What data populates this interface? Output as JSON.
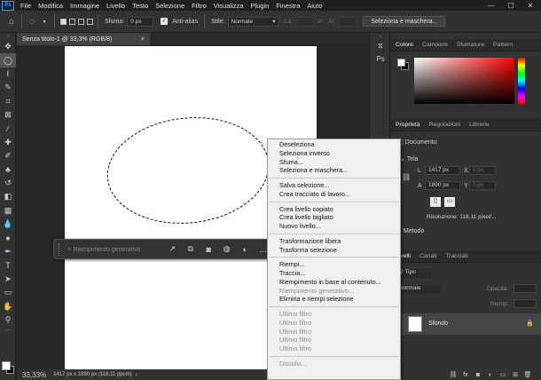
{
  "menubar": {
    "logo": "Ps",
    "items": [
      "File",
      "Modifica",
      "Immagine",
      "Livello",
      "Testo",
      "Selezione",
      "Filtro",
      "Visualizza",
      "Plugin",
      "Finestra",
      "Aiuto"
    ],
    "window_controls": [
      "—",
      "☐",
      "✕"
    ]
  },
  "options": {
    "home_icon": "home-icon",
    "marquee_icon": "ellipse-marquee-icon",
    "feather_label": "Sfuma:",
    "feather_value": "0 px",
    "antialias_label": "Anti-alias",
    "antialias_checked": true,
    "style_label": "Stile:",
    "style_value": "Normale",
    "width_label": "La:",
    "height_label": "Al:",
    "select_mask_button": "Seleziona e maschera..."
  },
  "document": {
    "tab_title": "Senza titolo-1 @ 33,3% (RGB/8)",
    "tab_close": "×",
    "canvas_color": "#ffffff"
  },
  "status": {
    "zoom": "33,33%",
    "dimensions": "1417 px x 1890 px (118,11 ppcm)"
  },
  "taskbar": {
    "generative_fill": "Riempimento generativo",
    "more_icon": "..."
  },
  "context_menu": {
    "groups": [
      [
        {
          "label": "Deseleziona",
          "enabled": true
        },
        {
          "label": "Seleziona inverso",
          "enabled": true
        },
        {
          "label": "Sfuma...",
          "enabled": true
        },
        {
          "label": "Seleziona e maschera...",
          "enabled": true
        }
      ],
      [
        {
          "label": "Salva selezione...",
          "enabled": true
        },
        {
          "label": "Crea tracciato di lavoro...",
          "enabled": true
        }
      ],
      [
        {
          "label": "Crea livello copiato",
          "enabled": true
        },
        {
          "label": "Crea livello tagliato",
          "enabled": true
        },
        {
          "label": "Nuovo livello...",
          "enabled": true
        }
      ],
      [
        {
          "label": "Trasformazione libera",
          "enabled": true
        },
        {
          "label": "Trasforma selezione",
          "enabled": true
        }
      ],
      [
        {
          "label": "Riempi...",
          "enabled": true
        },
        {
          "label": "Traccia...",
          "enabled": true
        },
        {
          "label": "Riempimento in base al contenuto...",
          "enabled": true
        },
        {
          "label": "Riempimento generativo...",
          "enabled": false
        },
        {
          "label": "Elimina e riempi selezione",
          "enabled": true
        }
      ],
      [
        {
          "label": "Ultimo filtro",
          "enabled": false
        },
        {
          "label": "Ultimo filtro",
          "enabled": false
        },
        {
          "label": "Ultimo filtro",
          "enabled": false
        },
        {
          "label": "Ultimo filtro",
          "enabled": false
        },
        {
          "label": "Ultimo filtro",
          "enabled": false
        }
      ],
      [
        {
          "label": "Dissolvi...",
          "enabled": false
        }
      ]
    ]
  },
  "color_panel": {
    "tabs": [
      "Colore",
      "Campioni",
      "Sfumature",
      "Pattern"
    ],
    "active_tab": "Colore",
    "foreground": "#ffffff",
    "background": "#000000"
  },
  "properties_panel": {
    "tabs": [
      "Proprietà",
      "Regolazioni",
      "Librerie"
    ],
    "active_tab": "Proprietà",
    "section": "Documento",
    "canvas_label": "Tela",
    "width_value": "1417 px",
    "height_value": "1890 px",
    "x_label": "X",
    "y_label": "Y",
    "x_placeholder": "0 px",
    "y_placeholder": "0 px",
    "w_label": "L",
    "h_label": "A",
    "resolution": "Risoluzione: 118,11 pixel/...",
    "mode_label": "Metodo"
  },
  "layers_panel": {
    "tabs": [
      "Livelli",
      "Canali",
      "Tracciati"
    ],
    "active_tab": "Livelli",
    "kind_label": "Tipo",
    "blend_mode": "Normale",
    "opacity_label": "Opacità:",
    "fill_label": "Riemp.:",
    "layer_name": "Sfondo"
  },
  "bottom_icons": [
    "link-icon",
    "fx-icon",
    "mask-icon",
    "adjustment-icon",
    "group-icon",
    "new-layer-icon",
    "trash-icon"
  ]
}
